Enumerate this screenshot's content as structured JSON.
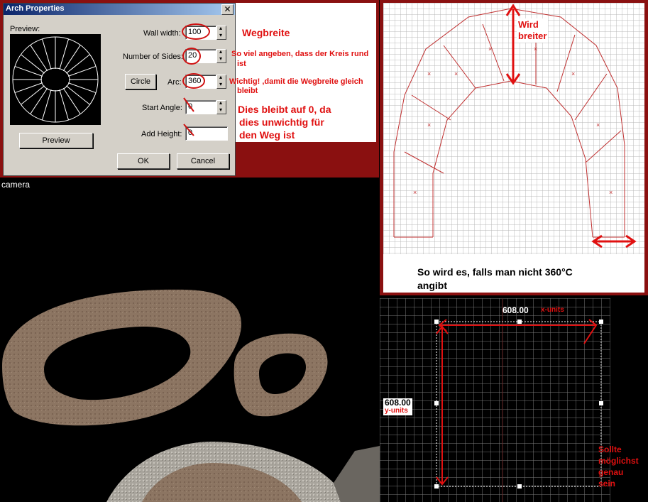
{
  "dialog": {
    "title": "Arch Properties",
    "close_glyph": "✕",
    "preview_label": "Preview:",
    "wall_width_label": "Wall width:",
    "wall_width_value": "100",
    "sides_label": "Number of Sides:",
    "sides_value": "20",
    "circle_button": "Circle",
    "arc_label": "Arc:",
    "arc_value": "360",
    "start_angle_label": "Start Angle:",
    "start_angle_value": "0",
    "add_height_label": "Add Height:",
    "add_height_value": "0",
    "preview_button": "Preview",
    "ok_button": "OK",
    "cancel_button": "Cancel"
  },
  "annotations": {
    "wegbreite": "Wegbreite",
    "sides_note_1": "So viel angeben, dass der Kreis rund",
    "sides_note_2": "ist",
    "arc_note_1": "Wichtig! ,damit die Wegbreite gleich",
    "arc_note_2": "bleibt",
    "angle_note_1": "Dies bleibt auf 0, da",
    "angle_note_2": "dies unwichtig für",
    "angle_note_3": "den Weg ist",
    "wird_1": "Wird",
    "wird_2": "breiter",
    "caption_1": "So wird es, falls man nicht 360°C",
    "caption_2": "angibt",
    "dim_x_value": "608.00",
    "dim_x_unit": "x-units",
    "dim_y_value": "608.00",
    "dim_y_unit": "y-units",
    "sollte_1": "Sollte",
    "sollte_2": "möglichst",
    "sollte_3": "genau",
    "sollte_4": "sein"
  },
  "camera": {
    "label": "camera"
  },
  "colors": {
    "annotation_red": "#e01010",
    "frame_red": "#8a1010",
    "dialog_gray": "#d4d0c8",
    "title_blue": "#0a246a",
    "ring_tan": "#8a7360"
  }
}
